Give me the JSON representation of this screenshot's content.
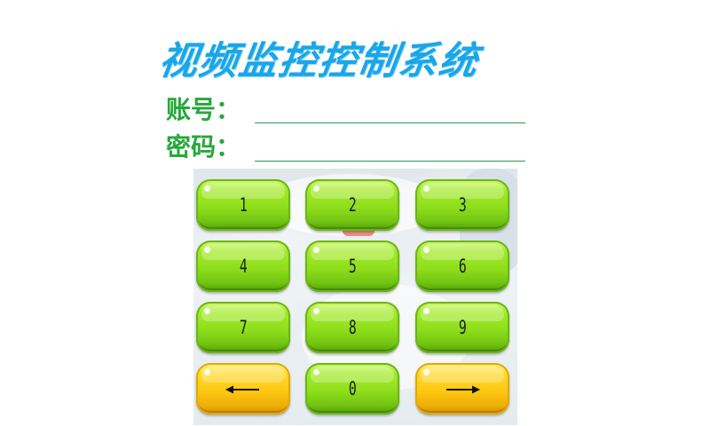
{
  "title": "视频监控控制系统",
  "login": {
    "account_label": "账号：",
    "account_value": "",
    "password_label": "密码：",
    "password_value": ""
  },
  "keypad": {
    "keys": [
      "1",
      "2",
      "3",
      "4",
      "5",
      "6",
      "7",
      "8",
      "9",
      "0"
    ],
    "backspace_icon": "left-arrow-icon",
    "enter_icon": "right-arrow-icon"
  },
  "colors": {
    "title": "#1aa6e8",
    "label": "#25a83a",
    "digit_key": "#8fde1b",
    "arrow_key": "#fbc510"
  }
}
